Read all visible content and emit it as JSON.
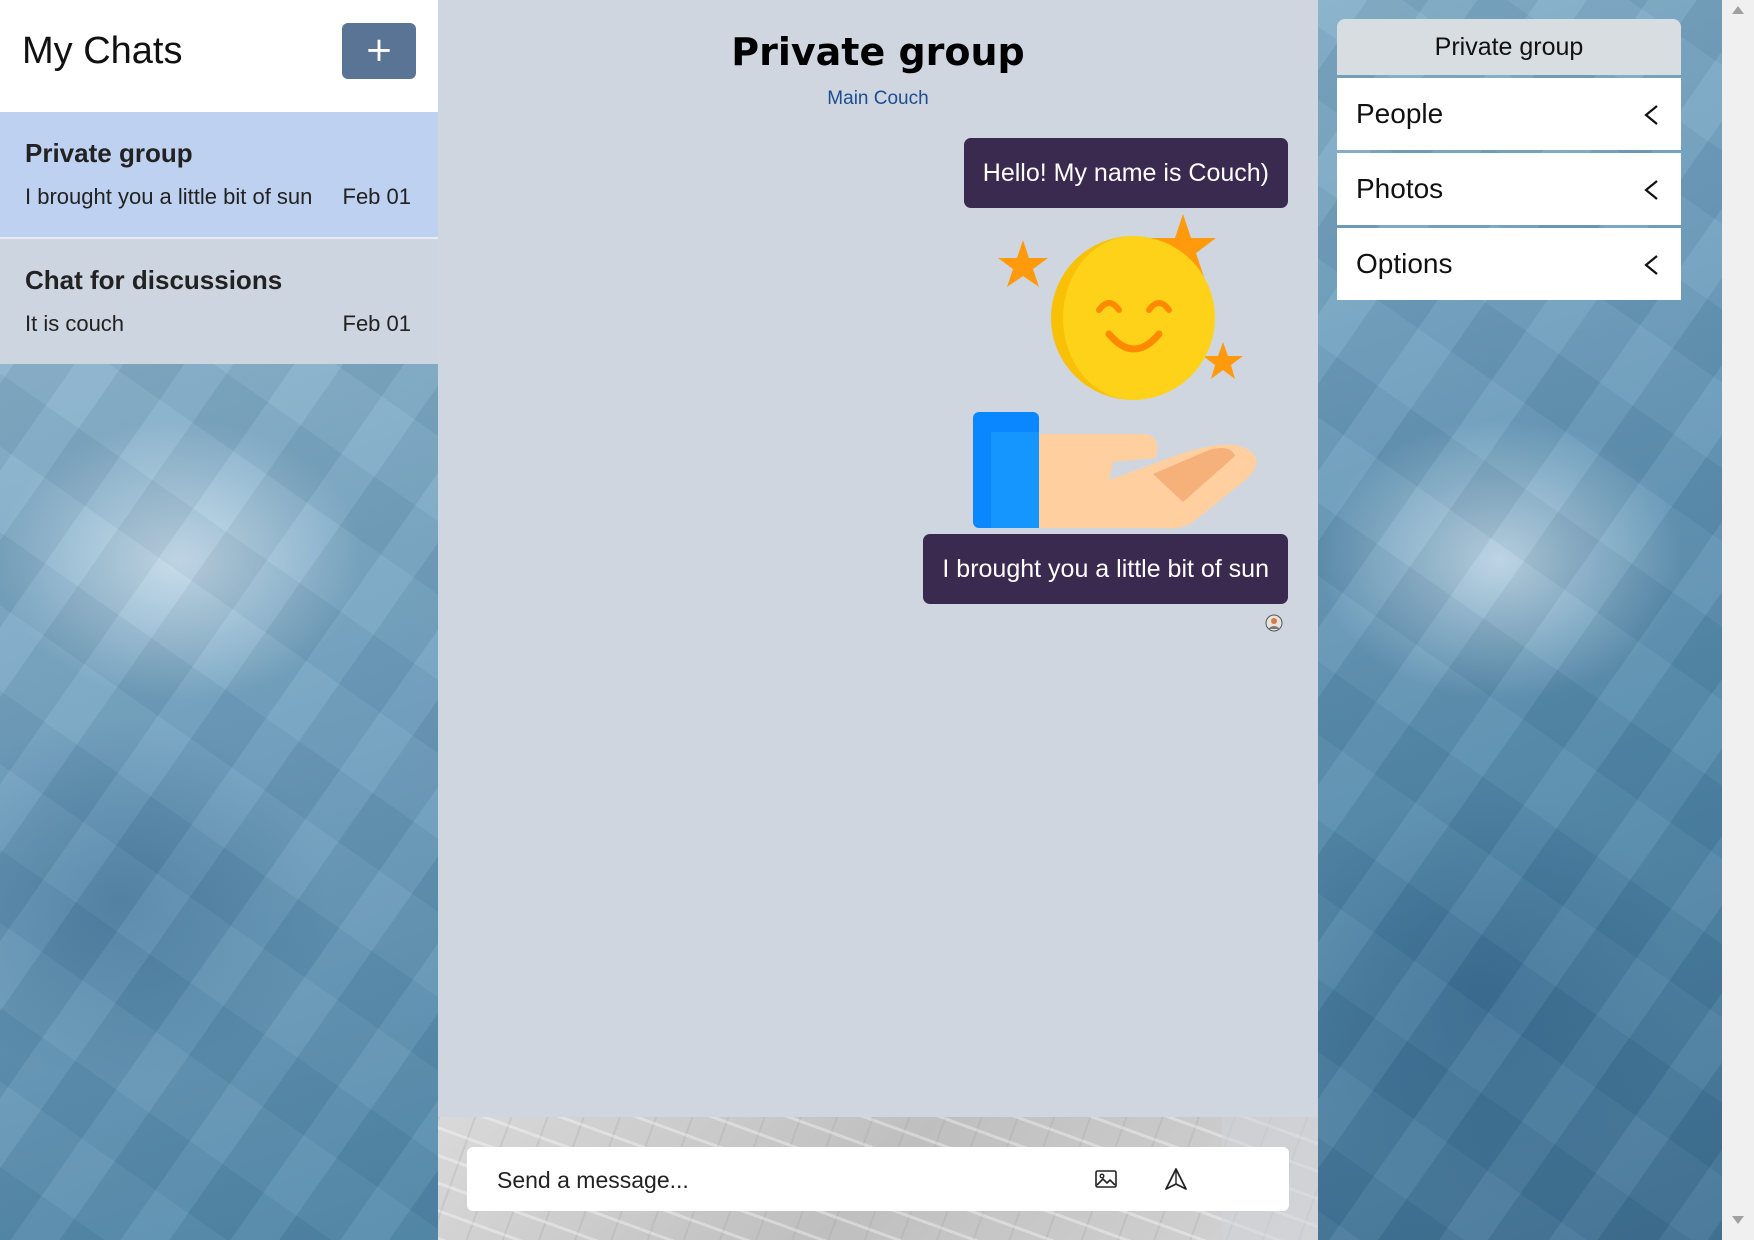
{
  "sidebar": {
    "title": "My Chats",
    "new_chat_label": "+",
    "chats": [
      {
        "name": "Private group",
        "preview": "I brought you a little bit of sun",
        "date": "Feb 01"
      },
      {
        "name": "Chat for discussions",
        "preview": "It is couch",
        "date": "Feb 01"
      }
    ]
  },
  "main": {
    "title": "Private group",
    "subtitle": "Main Couch",
    "messages": [
      {
        "text": "Hello! My name is Couch)"
      },
      {
        "text": "I brought you a little bit of sun"
      }
    ],
    "composer": {
      "placeholder": "Send a message..."
    }
  },
  "details": {
    "header": "Private group",
    "rows": [
      {
        "label": "People"
      },
      {
        "label": "Photos"
      },
      {
        "label": "Options"
      }
    ]
  },
  "colors": {
    "bubble": "#3a2a4f",
    "active_chat": "#bed1f0",
    "accent_button": "#5a7496",
    "subtitle": "#1d4c91"
  },
  "icons": [
    "plus-icon",
    "sun-sticker",
    "image-icon",
    "send-icon",
    "chevron-left-icon"
  ]
}
